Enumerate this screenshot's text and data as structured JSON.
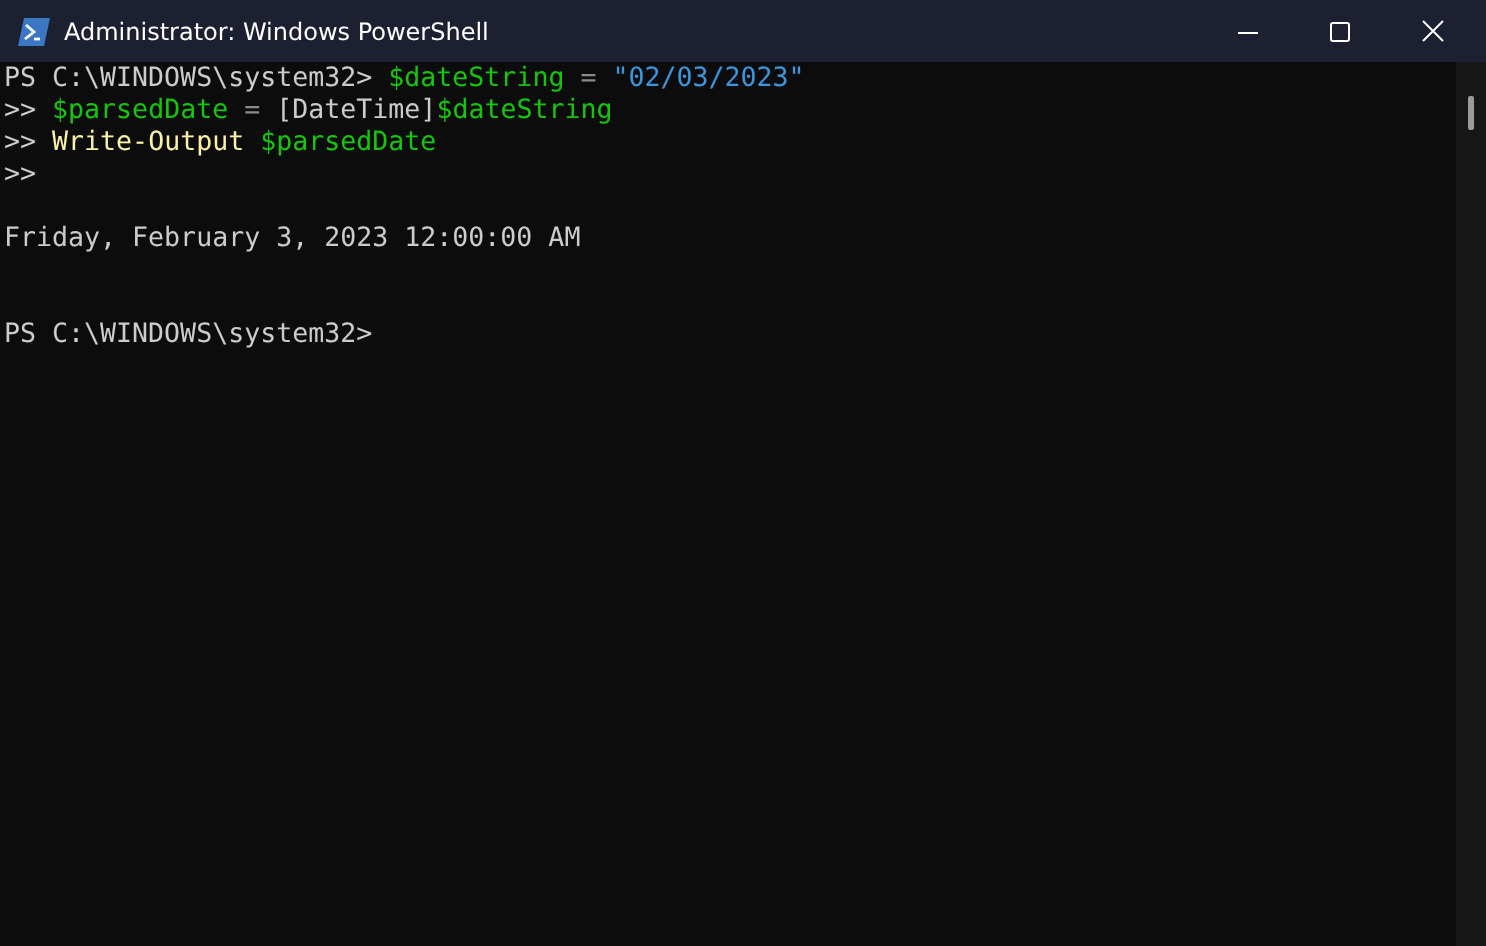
{
  "window": {
    "title": "Administrator: Windows PowerShell"
  },
  "console": {
    "lines": [
      {
        "kind": "text",
        "tokens": [
          {
            "kind": "prompt",
            "text": "PS C:\\WINDOWS\\system32> "
          },
          {
            "kind": "variable",
            "text": "$dateString"
          },
          {
            "kind": "operator",
            "text": " = "
          },
          {
            "kind": "string",
            "text": "\"02/03/2023\""
          }
        ]
      },
      {
        "kind": "text",
        "tokens": [
          {
            "kind": "prompt",
            "text": ">> "
          },
          {
            "kind": "variable",
            "text": "$parsedDate"
          },
          {
            "kind": "operator",
            "text": " = "
          },
          {
            "kind": "prompt",
            "text": "[DateTime]"
          },
          {
            "kind": "variable",
            "text": "$dateString"
          }
        ]
      },
      {
        "kind": "text",
        "tokens": [
          {
            "kind": "prompt",
            "text": ">> "
          },
          {
            "kind": "command",
            "text": "Write-Output "
          },
          {
            "kind": "variable",
            "text": "$parsedDate"
          }
        ]
      },
      {
        "kind": "text",
        "tokens": [
          {
            "kind": "prompt",
            "text": ">>"
          }
        ]
      },
      {
        "kind": "blank"
      },
      {
        "kind": "text",
        "tokens": [
          {
            "kind": "prompt",
            "text": "Friday, February 3, 2023 12:00:00 AM"
          }
        ]
      },
      {
        "kind": "blank"
      },
      {
        "kind": "blank"
      },
      {
        "kind": "text",
        "tokens": [
          {
            "kind": "prompt",
            "text": "PS C:\\WINDOWS\\system32>"
          }
        ]
      }
    ]
  }
}
